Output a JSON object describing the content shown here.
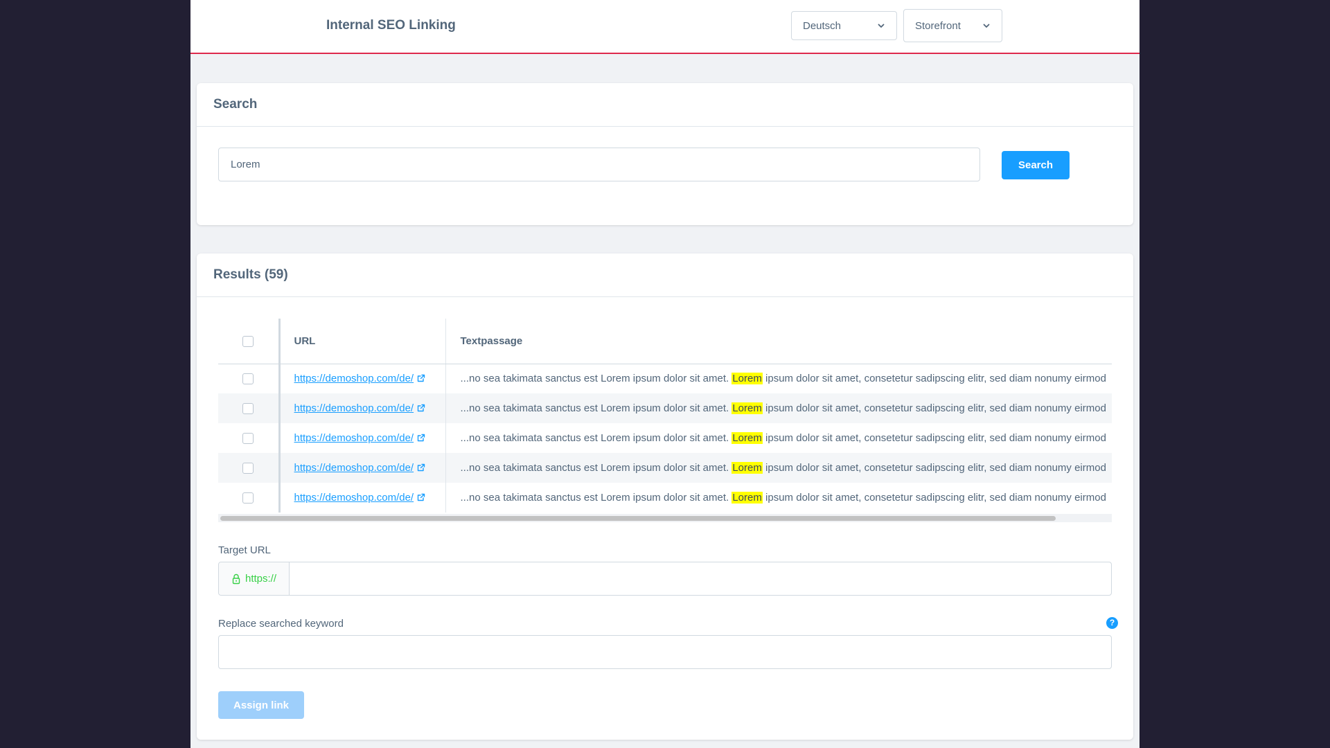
{
  "header": {
    "title": "Internal SEO Linking",
    "language_select": "Deutsch",
    "sales_channel_select": "Storefront"
  },
  "search": {
    "title": "Search",
    "input_value": "Lorem",
    "button_label": "Search"
  },
  "results": {
    "title": "Results (59)",
    "columns": [
      "URL",
      "Textpassage"
    ],
    "rows": [
      {
        "url": "https://demoshop.com/de/",
        "text_before": "...no sea takimata sanctus est Lorem ipsum dolor sit amet. ",
        "keyword": "Lorem",
        "text_after": " ipsum dolor sit amet, consetetur sadipscing elitr, sed diam nonumy eirmod"
      },
      {
        "url": "https://demoshop.com/de/",
        "text_before": "...no sea takimata sanctus est Lorem ipsum dolor sit amet. ",
        "keyword": "Lorem",
        "text_after": " ipsum dolor sit amet, consetetur sadipscing elitr, sed diam nonumy eirmod"
      },
      {
        "url": "https://demoshop.com/de/",
        "text_before": "...no sea takimata sanctus est Lorem ipsum dolor sit amet. ",
        "keyword": "Lorem",
        "text_after": " ipsum dolor sit amet, consetetur sadipscing elitr, sed diam nonumy eirmod"
      },
      {
        "url": "https://demoshop.com/de/",
        "text_before": "...no sea takimata sanctus est Lorem ipsum dolor sit amet. ",
        "keyword": "Lorem",
        "text_after": " ipsum dolor sit amet, consetetur sadipscing elitr, sed diam nonumy eirmod"
      },
      {
        "url": "https://demoshop.com/de/",
        "text_before": "...no sea takimata sanctus est Lorem ipsum dolor sit amet. ",
        "keyword": "Lorem",
        "text_after": " ipsum dolor sit amet, consetetur sadipscing elitr, sed diam nonumy eirmod"
      }
    ]
  },
  "form": {
    "target_url_label": "Target URL",
    "target_url_prefix": "https://",
    "target_url_value": "",
    "replace_label": "Replace searched keyword",
    "replace_value": "",
    "help_glyph": "?",
    "assign_button_label": "Assign link"
  },
  "colors": {
    "accent": "#189eff",
    "header_border": "#de294c",
    "highlight": "#ffff00",
    "secure_prefix": "#37d046",
    "page_backdrop": "#221f33"
  },
  "icons": [
    "chevron-down-icon",
    "external-link-icon",
    "lock-icon",
    "help-icon"
  ]
}
